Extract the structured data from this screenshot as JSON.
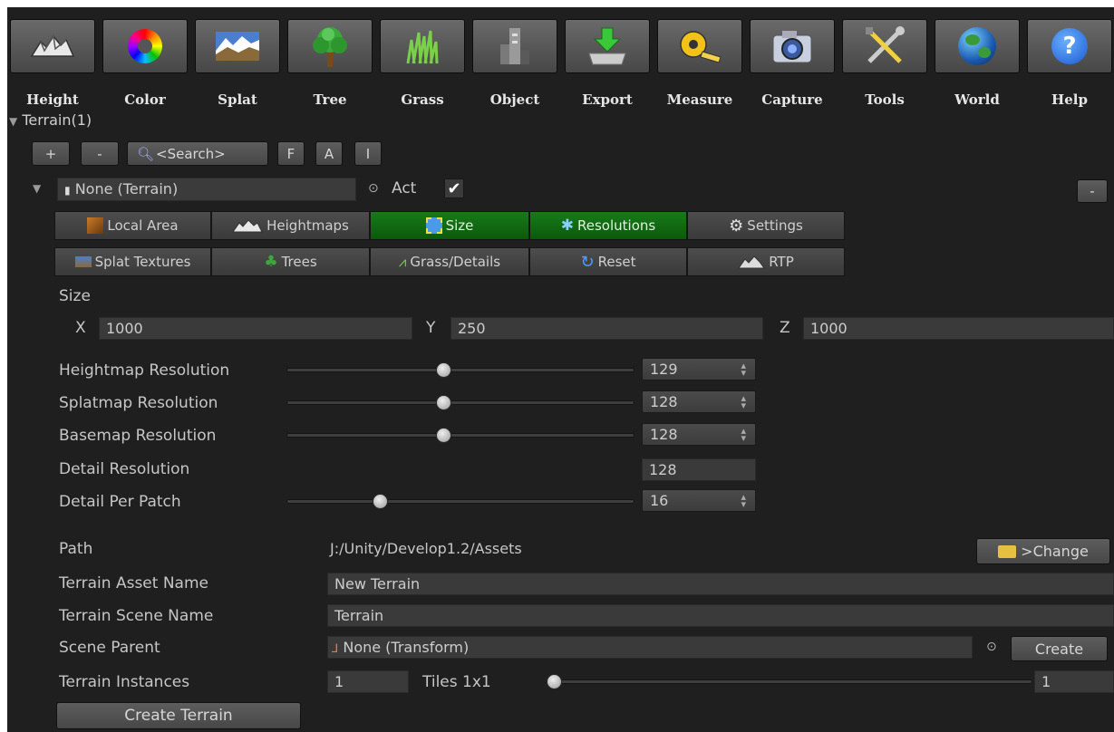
{
  "toolbar": [
    {
      "id": "height",
      "label": "Height",
      "icon": "height-mountain-icon"
    },
    {
      "id": "color",
      "label": "Color",
      "icon": "color-wheel-icon"
    },
    {
      "id": "splat",
      "label": "Splat",
      "icon": "splat-landscape-icon"
    },
    {
      "id": "tree",
      "label": "Tree",
      "icon": "tree-icon"
    },
    {
      "id": "grass",
      "label": "Grass",
      "icon": "grass-icon"
    },
    {
      "id": "object",
      "label": "Object",
      "icon": "object-building-icon"
    },
    {
      "id": "export",
      "label": "Export",
      "icon": "export-arrow-icon"
    },
    {
      "id": "measure",
      "label": "Measure",
      "icon": "measure-tape-icon"
    },
    {
      "id": "capture",
      "label": "Capture",
      "icon": "camera-icon"
    },
    {
      "id": "tools",
      "label": "Tools",
      "icon": "tools-wrench-icon"
    },
    {
      "id": "world",
      "label": "World",
      "icon": "globe-icon"
    },
    {
      "id": "help",
      "label": "Help",
      "icon": "help-question-icon"
    }
  ],
  "tree_header": "Terrain(1)",
  "list_controls": {
    "add": "+",
    "remove": "-",
    "search": "<Search>",
    "f": "F",
    "a": "A",
    "i": "I"
  },
  "terrain_entry": {
    "object_field": "None (Terrain)",
    "act_label": "Act",
    "remove": "-"
  },
  "tabs_row1": [
    {
      "label": "Local Area",
      "icon": "local-area-icon",
      "active": false
    },
    {
      "label": "Heightmaps",
      "icon": "heightmaps-icon",
      "active": false
    },
    {
      "label": "Size",
      "icon": "size-icon",
      "active": true
    },
    {
      "label": "Resolutions",
      "icon": "resolutions-icon",
      "active": true
    },
    {
      "label": "Settings",
      "icon": "settings-gear-icon",
      "active": false
    }
  ],
  "tabs_row2": [
    {
      "label": "Splat Textures",
      "icon": "splat-textures-icon",
      "active": false
    },
    {
      "label": "Trees",
      "icon": "trees-icon",
      "active": false
    },
    {
      "label": "Grass/Details",
      "icon": "grass-details-icon",
      "active": false
    },
    {
      "label": "Reset",
      "icon": "reset-icon",
      "active": false
    },
    {
      "label": "RTP",
      "icon": "rtp-icon",
      "active": false
    }
  ],
  "size": {
    "label": "Size",
    "x_label": "X",
    "x": "1000",
    "y_label": "Y",
    "y": "250",
    "z_label": "Z",
    "z": "1000"
  },
  "resolutions": {
    "heightmap": {
      "label": "Heightmap Resolution",
      "value": "129",
      "level": 0.45
    },
    "splatmap": {
      "label": "Splatmap Resolution",
      "value": "128",
      "level": 0.45
    },
    "basemap": {
      "label": "Basemap Resolution",
      "value": "128",
      "level": 0.45
    },
    "detail": {
      "label": "Detail Resolution",
      "value": "128"
    },
    "detail_per_patch": {
      "label": "Detail Per Patch",
      "value": "16",
      "level": 0.26
    }
  },
  "path": {
    "label": "Path",
    "value": "J:/Unity/Develop1.2/Assets",
    "change": ">Change"
  },
  "asset_name": {
    "label": "Terrain Asset Name",
    "value": "New Terrain"
  },
  "scene_name": {
    "label": "Terrain Scene Name",
    "value": "Terrain"
  },
  "scene_parent": {
    "label": "Scene Parent",
    "value": "None (Transform)",
    "create": "Create"
  },
  "instances": {
    "label": "Terrain Instances",
    "value": "1",
    "tiles_label": "Tiles 1x1",
    "tiles_value": "1",
    "level": 0.0
  },
  "create_terrain": "Create Terrain",
  "colors": {
    "panel": "#1f1f1f",
    "active_tab": "#197a19",
    "field": "#3a3a3a"
  }
}
